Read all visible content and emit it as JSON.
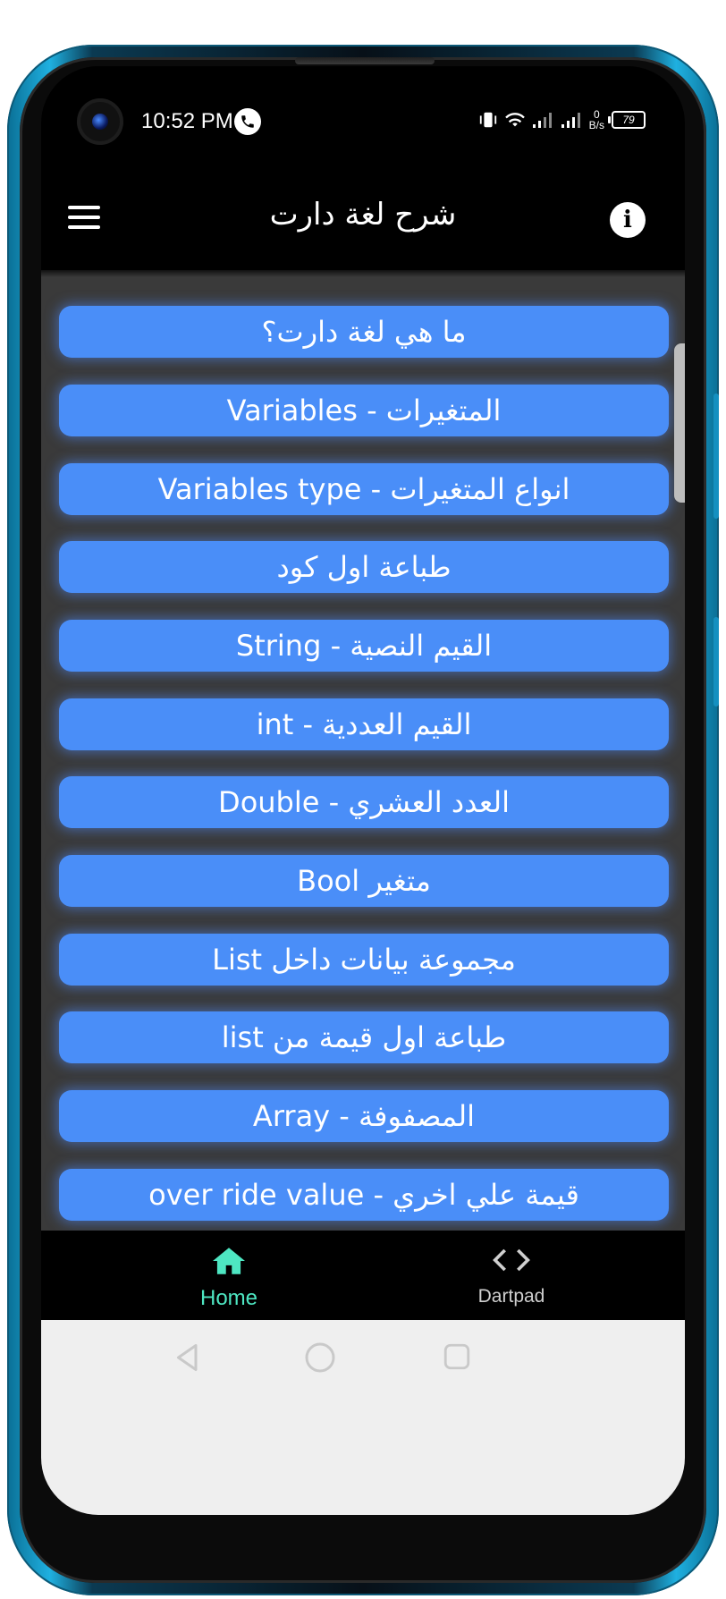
{
  "status_bar": {
    "time": "10:52 PM",
    "speed_value": "0",
    "speed_unit": "B/s",
    "battery": "79"
  },
  "app_bar": {
    "title": "شرح لغة دارت",
    "menu_icon": "hamburger-menu-icon",
    "info_icon": "info-icon"
  },
  "lessons": [
    "ما هي لغة دارت؟",
    "Variables - المتغيرات",
    "Variables type -  انواع المتغيرات",
    "طباعة اول كود",
    "String - القيم النصية",
    "int - القيم العددية",
    "Double - العدد العشري",
    "متغير Bool",
    "مجموعة بيانات داخل List",
    "طباعة اول قيمة من list",
    "Array - المصفوفة",
    "over ride value - قيمة علي اخري"
  ],
  "bottom_nav": {
    "home_label": "Home",
    "dartpad_label": "Dartpad",
    "active_color": "#4ee6c2"
  },
  "colors": {
    "button_blue": "#4a8ef8",
    "list_background": "#3a3a3a",
    "phone_frame": "#1fb0e0"
  }
}
